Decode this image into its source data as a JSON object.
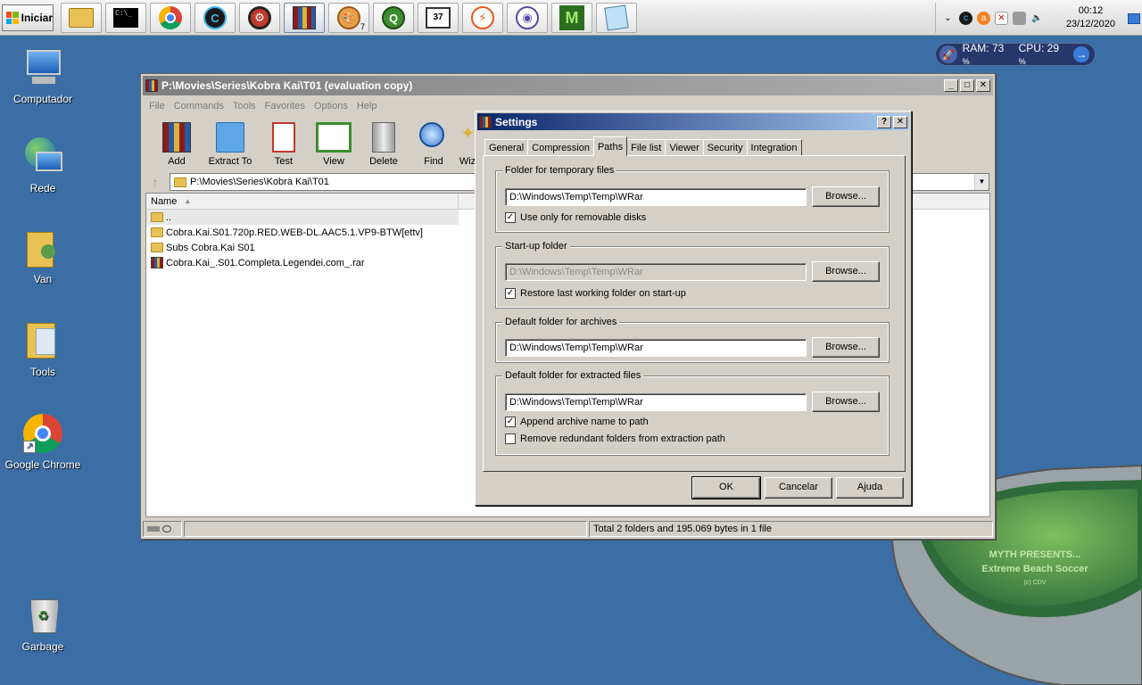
{
  "taskbar": {
    "start_label": "Iniciar",
    "apps": [
      {
        "icon": "file-explorer-icon",
        "label": ""
      },
      {
        "icon": "command-prompt-icon",
        "label": "C:\\_"
      },
      {
        "icon": "chrome-icon",
        "label": ""
      },
      {
        "icon": "ccleaner-icon",
        "label": "C"
      },
      {
        "icon": "pc-repair-icon",
        "label": ""
      },
      {
        "icon": "winrar-icon",
        "label": ""
      },
      {
        "icon": "paint-palette-icon",
        "label": "",
        "badge": "7"
      },
      {
        "icon": "globe-search-icon",
        "label": ""
      },
      {
        "icon": "video-editor-icon",
        "label": "37"
      },
      {
        "icon": "flash-icon",
        "label": ""
      },
      {
        "icon": "torrent-icon",
        "label": ""
      },
      {
        "icon": "muvia-icon",
        "label": "M"
      },
      {
        "icon": "notepad-icon",
        "label": ""
      }
    ],
    "clock_time": "00:12",
    "clock_date": "23/12/2020"
  },
  "rescue_widget": {
    "ram_label": "RAM: 73",
    "cpu_label": "CPU: 29",
    "percent": "%"
  },
  "desktop": {
    "icons": [
      {
        "label": "Computador"
      },
      {
        "label": "Rede"
      },
      {
        "label": "Van"
      },
      {
        "label": "Tools"
      },
      {
        "label": "Google Chrome"
      },
      {
        "label": "Garbage"
      }
    ]
  },
  "gadget": {
    "line1": "MYTH PRESENTS...",
    "line2": "Extreme Beach Soccer",
    "line3": "(c) CDV"
  },
  "winrar": {
    "title": "P:\\Movies\\Series\\Kobra Kai\\T01 (evaluation copy)",
    "menu": [
      "File",
      "Commands",
      "Tools",
      "Favorites",
      "Options",
      "Help"
    ],
    "tools": [
      "Add",
      "Extract To",
      "Test",
      "View",
      "Delete",
      "Find",
      "Wiz"
    ],
    "address": "P:\\Movies\\Series\\Kobra Kai\\T01",
    "column_name": "Name",
    "files": [
      {
        "name": "..",
        "type": "folder"
      },
      {
        "name": "Cobra.Kai.S01.720p.RED.WEB-DL.AAC5.1.VP9-BTW[ettv]",
        "type": "folder"
      },
      {
        "name": "Subs Cobra.Kai S01",
        "type": "folder"
      },
      {
        "name": "Cobra.Kai_.S01.Completa.Legendei.com_.rar",
        "type": "rar"
      }
    ],
    "status": "Total 2 folders and 195.069 bytes in 1 file"
  },
  "settings": {
    "title": "Settings",
    "tabs": [
      "General",
      "Compression",
      "Paths",
      "File list",
      "Viewer",
      "Security",
      "Integration"
    ],
    "active_tab": "Paths",
    "groups": {
      "temp": {
        "title": "Folder for temporary files",
        "value": "D:\\Windows\\Temp\\Temp\\WRar",
        "check_label": "Use only for removable disks",
        "checked": true
      },
      "startup": {
        "title": "Start-up folder",
        "value": "D:\\Windows\\Temp\\Temp\\WRar",
        "check_label": "Restore last working folder on start-up",
        "checked": true
      },
      "archives": {
        "title": "Default folder for archives",
        "value": "D:\\Windows\\Temp\\Temp\\WRar"
      },
      "extracted": {
        "title": "Default folder for extracted files",
        "value": "D:\\Windows\\Temp\\Temp\\WRar",
        "check1_label": "Append archive name to path",
        "check1": true,
        "check2_label": "Remove redundant folders from extraction path",
        "check2": false
      }
    },
    "browse_label": "Browse...",
    "ok_label": "OK",
    "cancel_label": "Cancelar",
    "help_label": "Ajuda"
  }
}
